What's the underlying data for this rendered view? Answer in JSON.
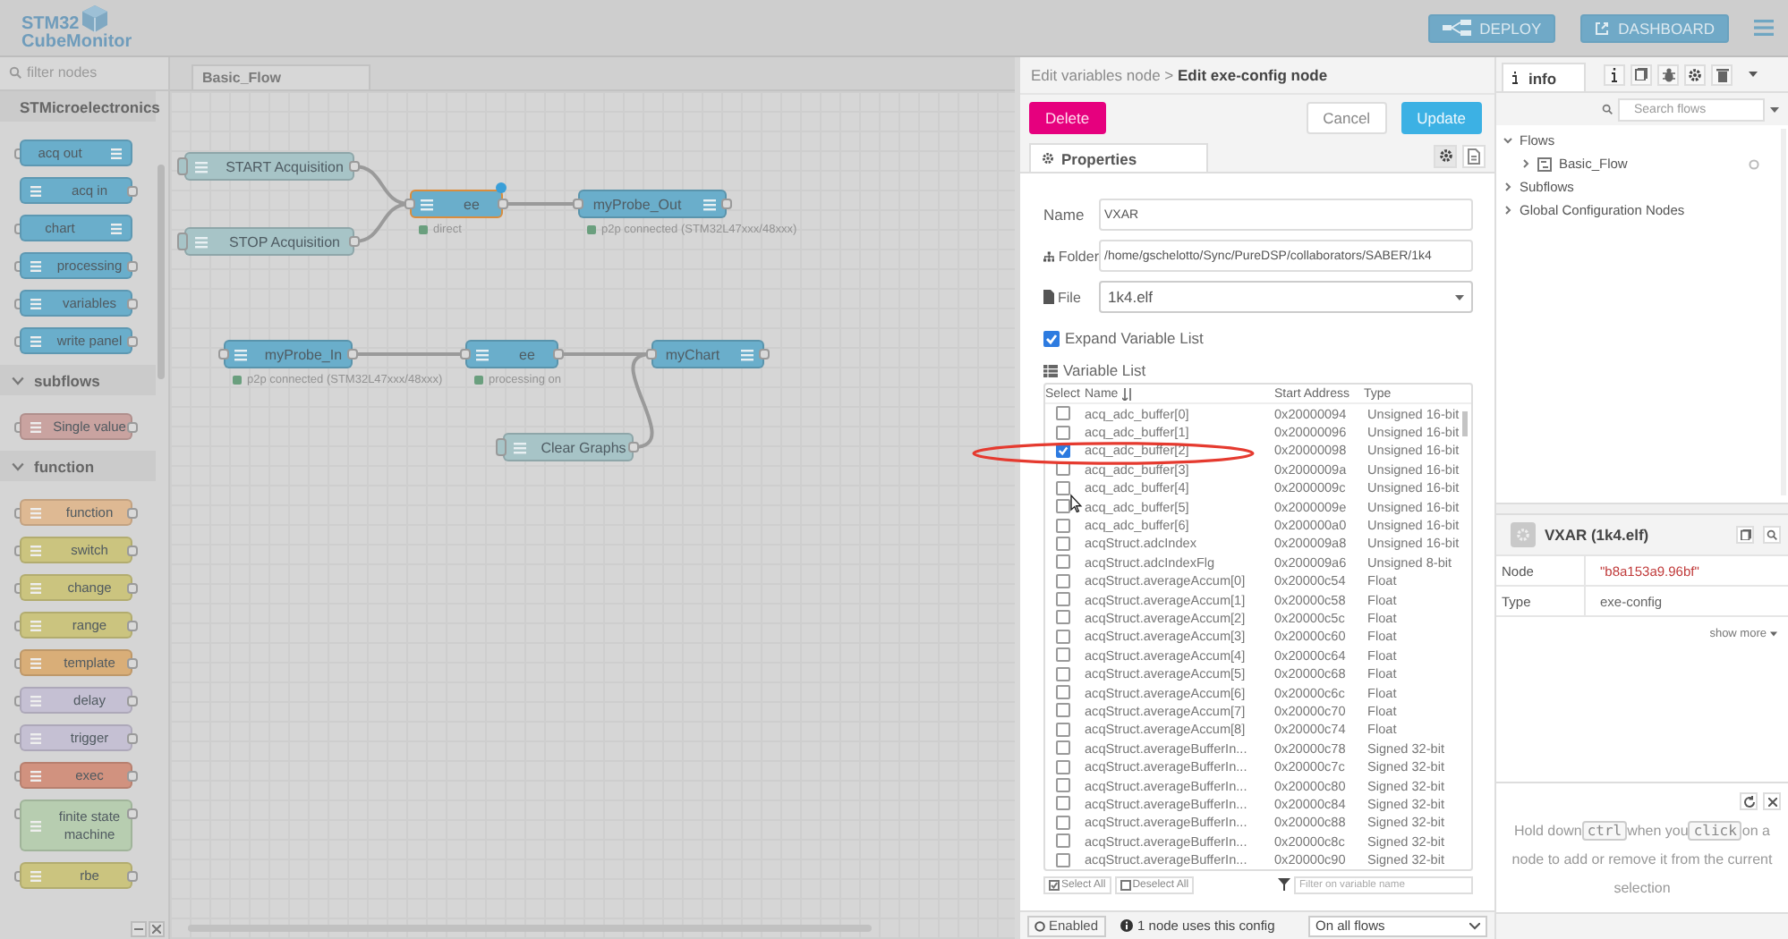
{
  "header": {
    "logo_top": "STM32",
    "logo_bottom": "CubeMonitor",
    "deploy": "DEPLOY",
    "dashboard": "DASHBOARD"
  },
  "palette": {
    "filter_placeholder": "filter nodes",
    "categories": [
      {
        "name": "STMicroelectronics",
        "expanded": true,
        "nodes": [
          {
            "label": "acq out",
            "color": "#6aaecb",
            "input": true,
            "output": false,
            "icon_right": true
          },
          {
            "label": "acq in",
            "color": "#6aaecb",
            "input": false,
            "output": true,
            "icon_right": false
          },
          {
            "label": "chart",
            "color": "#6aaecb",
            "input": true,
            "output": false,
            "icon_right": true
          },
          {
            "label": "processing",
            "color": "#6aaecb",
            "input": true,
            "output": true,
            "icon_right": false
          },
          {
            "label": "variables",
            "color": "#6aaecb",
            "input": true,
            "output": true,
            "icon_right": false
          },
          {
            "label": "write panel",
            "color": "#6aaecb",
            "input": true,
            "output": true,
            "icon_right": false
          }
        ]
      },
      {
        "name": "subflows",
        "expanded": true,
        "nodes": [
          {
            "label": "Single value",
            "color": "#c9a3a0",
            "input": true,
            "output": true,
            "icon_right": false
          }
        ]
      },
      {
        "name": "function",
        "expanded": true,
        "nodes": [
          {
            "label": "function",
            "color": "#deb993",
            "input": true,
            "output": true,
            "icon_right": false
          },
          {
            "label": "switch",
            "color": "#cbc47f",
            "input": true,
            "output": true,
            "icon_right": false
          },
          {
            "label": "change",
            "color": "#cbc47f",
            "input": true,
            "output": true,
            "icon_right": false
          },
          {
            "label": "range",
            "color": "#cbc47f",
            "input": true,
            "output": true,
            "icon_right": false
          },
          {
            "label": "template",
            "color": "#d9ae78",
            "input": true,
            "output": true,
            "icon_right": false
          },
          {
            "label": "delay",
            "color": "#c5c0d3",
            "input": true,
            "output": true,
            "icon_right": false
          },
          {
            "label": "trigger",
            "color": "#c5c0d3",
            "input": true,
            "output": true,
            "icon_right": false
          },
          {
            "label": "exec",
            "color": "#d1927f",
            "input": true,
            "output": true,
            "icon_right": false
          },
          {
            "label": "finite state machine",
            "color": "#b7cdb0",
            "input": true,
            "output": true,
            "icon_right": false
          },
          {
            "label": "rbe",
            "color": "#cbc47f",
            "input": true,
            "output": true,
            "icon_right": false
          }
        ]
      }
    ]
  },
  "workspace": {
    "tabs": [
      {
        "label": "Basic_Flow",
        "selected": true
      }
    ],
    "nodes": [
      {
        "kind": "inject",
        "label": "START Acquisition",
        "color": "#a7c4c7",
        "selected": false,
        "icon_right": false
      },
      {
        "kind": "inject",
        "label": "STOP Acquisition",
        "color": "#a7c4c7",
        "selected": false,
        "icon_right": false
      },
      {
        "kind": "node",
        "label": "ee",
        "color": "#6aaecb",
        "selected": true,
        "icon_right": false,
        "status": "direct"
      },
      {
        "kind": "node",
        "label": "myProbe_Out",
        "color": "#6aaecb",
        "selected": false,
        "icon_right": true,
        "status": "p2p connected (STM32L47xxx/48xxx)"
      },
      {
        "kind": "node",
        "label": "myProbe_In",
        "color": "#6aaecb",
        "selected": false,
        "icon_right": false,
        "status": "p2p connected (STM32L47xxx/48xxx)"
      },
      {
        "kind": "node",
        "label": "ee",
        "color": "#6aaecb",
        "selected": false,
        "icon_right": false,
        "status": "processing on"
      },
      {
        "kind": "node",
        "label": "myChart",
        "color": "#6aaecb",
        "selected": false,
        "icon_right": true
      },
      {
        "kind": "inject",
        "label": "Clear Graphs",
        "color": "#a7c4c7",
        "selected": false,
        "icon_right": false
      }
    ]
  },
  "tray": {
    "breadcrumb": "Edit variables node > **Edit exe-config node**",
    "delete": "Delete",
    "cancel": "Cancel",
    "update": "Update",
    "tab": "Properties",
    "name_label": "Name",
    "name_value": "VXAR",
    "folder_label": "Folder",
    "folder_value": "/home/gschelotto/Sync/PureDSP/collaborators/SABER/1k4",
    "file_label": "File",
    "file_value": "1k4.elf",
    "expand": {
      "label": "Expand Variable List",
      "checked": true
    },
    "list_title": "Variable List",
    "columns": [
      "Select",
      "Name",
      "Start Address",
      "Type"
    ],
    "rows": [
      {
        "name": "acq_adc_buffer[0]",
        "address": "0x20000094",
        "type": "Unsigned 16-bit",
        "checked": false
      },
      {
        "name": "acq_adc_buffer[1]",
        "address": "0x20000096",
        "type": "Unsigned 16-bit",
        "checked": false
      },
      {
        "name": "acq_adc_buffer[2]",
        "address": "0x20000098",
        "type": "Unsigned 16-bit",
        "checked": true
      },
      {
        "name": "acq_adc_buffer[3]",
        "address": "0x2000009a",
        "type": "Unsigned 16-bit",
        "checked": false
      },
      {
        "name": "acq_adc_buffer[4]",
        "address": "0x2000009c",
        "type": "Unsigned 16-bit",
        "checked": false
      },
      {
        "name": "acq_adc_buffer[5]",
        "address": "0x2000009e",
        "type": "Unsigned 16-bit",
        "checked": false
      },
      {
        "name": "acq_adc_buffer[6]",
        "address": "0x200000a0",
        "type": "Unsigned 16-bit",
        "checked": false
      },
      {
        "name": "acqStruct.adcIndex",
        "address": "0x200009a8",
        "type": "Unsigned 16-bit",
        "checked": false
      },
      {
        "name": "acqStruct.adcIndexFlg",
        "address": "0x200009a6",
        "type": "Unsigned 8-bit",
        "checked": false
      },
      {
        "name": "acqStruct.averageAccum[0]",
        "address": "0x20000c54",
        "type": "Float",
        "checked": false
      },
      {
        "name": "acqStruct.averageAccum[1]",
        "address": "0x20000c58",
        "type": "Float",
        "checked": false
      },
      {
        "name": "acqStruct.averageAccum[2]",
        "address": "0x20000c5c",
        "type": "Float",
        "checked": false
      },
      {
        "name": "acqStruct.averageAccum[3]",
        "address": "0x20000c60",
        "type": "Float",
        "checked": false
      },
      {
        "name": "acqStruct.averageAccum[4]",
        "address": "0x20000c64",
        "type": "Float",
        "checked": false
      },
      {
        "name": "acqStruct.averageAccum[5]",
        "address": "0x20000c68",
        "type": "Float",
        "checked": false
      },
      {
        "name": "acqStruct.averageAccum[6]",
        "address": "0x20000c6c",
        "type": "Float",
        "checked": false
      },
      {
        "name": "acqStruct.averageAccum[7]",
        "address": "0x20000c70",
        "type": "Float",
        "checked": false
      },
      {
        "name": "acqStruct.averageAccum[8]",
        "address": "0x20000c74",
        "type": "Float",
        "checked": false
      },
      {
        "name": "acqStruct.averageBufferIn...",
        "address": "0x20000c78",
        "type": "Signed 32-bit",
        "checked": false
      },
      {
        "name": "acqStruct.averageBufferIn...",
        "address": "0x20000c7c",
        "type": "Signed 32-bit",
        "checked": false
      },
      {
        "name": "acqStruct.averageBufferIn...",
        "address": "0x20000c80",
        "type": "Signed 32-bit",
        "checked": false
      },
      {
        "name": "acqStruct.averageBufferIn...",
        "address": "0x20000c84",
        "type": "Signed 32-bit",
        "checked": false
      },
      {
        "name": "acqStruct.averageBufferIn...",
        "address": "0x20000c88",
        "type": "Signed 32-bit",
        "checked": false
      },
      {
        "name": "acqStruct.averageBufferIn...",
        "address": "0x20000c8c",
        "type": "Signed 32-bit",
        "checked": false
      },
      {
        "name": "acqStruct.averageBufferIn...",
        "address": "0x20000c90",
        "type": "Signed 32-bit",
        "checked": false
      }
    ],
    "select_all": "Select All",
    "deselect_all": "Deselect All",
    "filter_placeholder": "Filter on variable name",
    "enabled": "Enabled",
    "usage": "1 node uses this config",
    "scope": "On all flows"
  },
  "sidebar": {
    "tab": "info",
    "search_placeholder": "Search flows",
    "tree": [
      {
        "label": "Flows",
        "expanded": true,
        "children": [
          {
            "label": "Basic_Flow",
            "expanded": false
          }
        ]
      },
      {
        "label": "Subflows",
        "expanded": false
      },
      {
        "label": "Global Configuration Nodes",
        "expanded": false
      }
    ],
    "node_title": "VXAR (1k4.elf)",
    "props": [
      {
        "key": "Node",
        "value": "\"b8a153a9.96bf\"",
        "kind": "id"
      },
      {
        "key": "Type",
        "value": "exe-config",
        "kind": "text"
      }
    ],
    "show_more": "show more",
    "hint": [
      {
        "kind": "text",
        "text": "Hold down"
      },
      {
        "kind": "key",
        "text": "ctrl"
      },
      {
        "kind": "text",
        "text": "when you"
      },
      {
        "kind": "key",
        "text": "click"
      },
      {
        "kind": "text",
        "text": "on a node to add or remove it from the current selection"
      }
    ]
  }
}
